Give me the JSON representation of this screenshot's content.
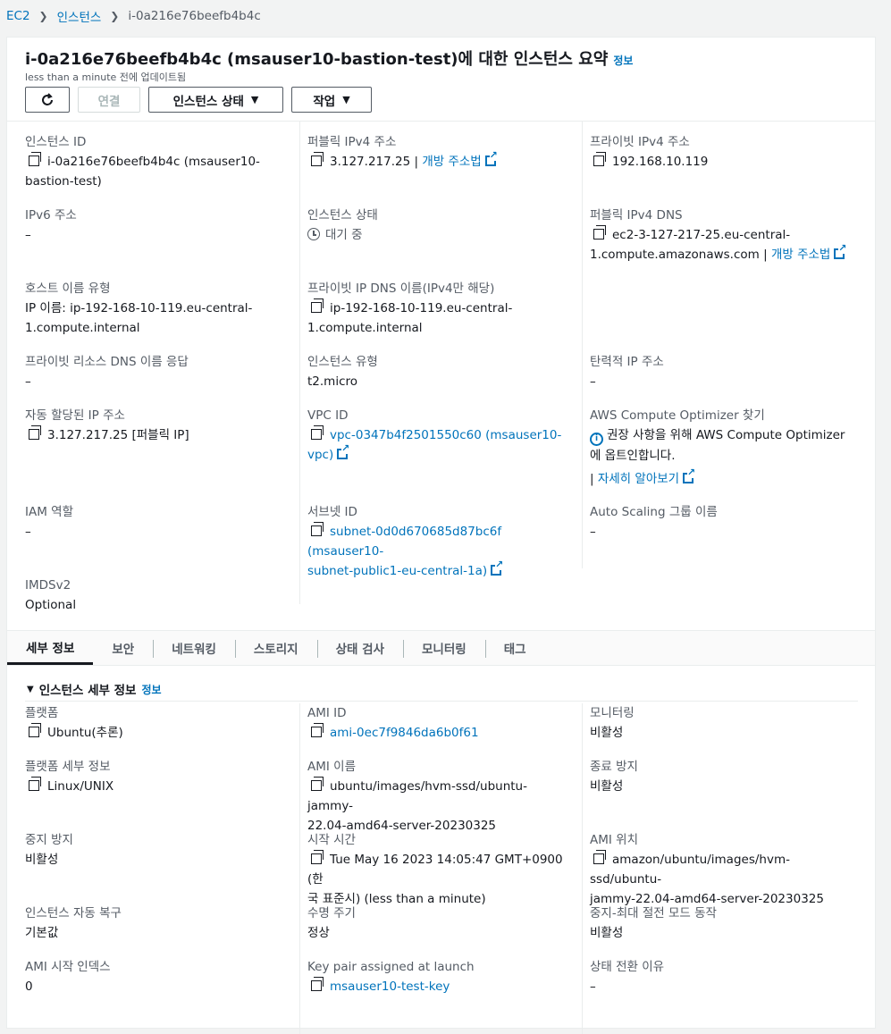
{
  "breadcrumb": {
    "root": "EC2",
    "instances": "인스턴스",
    "current": "i-0a216e76beefb4b4c"
  },
  "header": {
    "title": "i-0a216e76beefb4b4c (msauser10-bastion-test)에 대한 인스턴스 요약",
    "info": "정보",
    "updated": "less than a minute 전에 업데이트됨",
    "connect": "연결",
    "instance_state": "인스턴스 상태",
    "actions": "작업"
  },
  "summary": {
    "instance_id_label": "인스턴스 ID",
    "instance_id_value": "i-0a216e76beefb4b4c (msauser10-",
    "instance_id_value2": "bastion-test)",
    "public_ipv4_label": "퍼블릭 IPv4 주소",
    "public_ipv4_value": "3.127.217.25",
    "open_address": "개방 주소법",
    "private_ipv4_label": "프라이빗 IPv4 주소",
    "private_ipv4_value": "192.168.10.119",
    "ipv6_label": "IPv6 주소",
    "ipv6_value": "–",
    "state_label": "인스턴스 상태",
    "state_value": "대기 중",
    "public_dns_label": "퍼블릭 IPv4 DNS",
    "public_dns_value": "ec2-3-127-217-25.eu-central-",
    "public_dns_value2": "1.compute.amazonaws.com",
    "hostname_type_label": "호스트 이름 유형",
    "hostname_type_value": "IP 이름: ip-192-168-10-119.eu-central-",
    "hostname_type_value2": "1.compute.internal",
    "private_dns_label": "프라이빗 IP DNS 이름(IPv4만 해당)",
    "private_dns_value": "ip-192-168-10-119.eu-central-",
    "private_dns_value2": "1.compute.internal",
    "resource_dns_label": "프라이빗 리소스 DNS 이름 응답",
    "resource_dns_value": "–",
    "instance_type_label": "인스턴스 유형",
    "instance_type_value": "t2.micro",
    "elastic_ip_label": "탄력적 IP 주소",
    "elastic_ip_value": "–",
    "auto_ip_label": "자동 할당된 IP 주소",
    "auto_ip_value": "3.127.217.25 [퍼블릭 IP]",
    "vpc_label": "VPC ID",
    "vpc_value": "vpc-0347b4f2501550c60 (msauser10-",
    "vpc_value2": "vpc)",
    "optimizer_label": "AWS Compute Optimizer 찾기",
    "optimizer_value": "권장 사항을 위해 AWS Compute Optimizer",
    "optimizer_value2": "에 옵트인합니다.",
    "learn_more": "자세히 알아보기",
    "iam_label": "IAM 역할",
    "iam_value": "–",
    "subnet_label": "서브넷 ID",
    "subnet_value": "subnet-0d0d670685d87bc6f (msauser10-",
    "subnet_value2": "subnet-public1-eu-central-1a)",
    "asg_label": "Auto Scaling 그룹 이름",
    "asg_value": "–",
    "imds_label": "IMDSv2",
    "imds_value": "Optional"
  },
  "tabs": [
    "세부 정보",
    "보안",
    "네트워킹",
    "스토리지",
    "상태 검사",
    "모니터링",
    "태그"
  ],
  "details": {
    "section_title": "인스턴스 세부 정보",
    "section_info": "정보",
    "platform_label": "플랫폼",
    "platform_value": "Ubuntu(추론)",
    "ami_id_label": "AMI ID",
    "ami_id_value": "ami-0ec7f9846da6b0f61",
    "monitoring_label": "모니터링",
    "monitoring_value": "비활성",
    "platform_detail_label": "플랫폼 세부 정보",
    "platform_detail_value": "Linux/UNIX",
    "ami_name_label": "AMI 이름",
    "ami_name_value": "ubuntu/images/hvm-ssd/ubuntu-jammy-",
    "ami_name_value2": "22.04-amd64-server-20230325",
    "termination_label": "종료 방지",
    "termination_value": "비활성",
    "stop_protect_label": "중지 방지",
    "stop_protect_value": "비활성",
    "launch_time_label": "시작 시간",
    "launch_time_value": "Tue May 16 2023 14:05:47 GMT+0900 (한",
    "launch_time_value2": "국 표준시) (less than a minute)",
    "ami_location_label": "AMI 위치",
    "ami_location_value": "amazon/ubuntu/images/hvm-ssd/ubuntu-",
    "ami_location_value2": "jammy-22.04-amd64-server-20230325",
    "recovery_label": "인스턴스 자동 복구",
    "recovery_value": "기본값",
    "lifecycle_label": "수명 주기",
    "lifecycle_value": "정상",
    "hibernate_label": "중지-최대 절전 모드 동작",
    "hibernate_value": "비활성",
    "ami_launch_index_label": "AMI 시작 인덱스",
    "ami_launch_index_value": "0",
    "key_pair_label": "Key pair assigned at launch",
    "key_pair_value": "msauser10-test-key",
    "state_reason_label": "상태 전환 이유",
    "state_reason_value": "–"
  }
}
